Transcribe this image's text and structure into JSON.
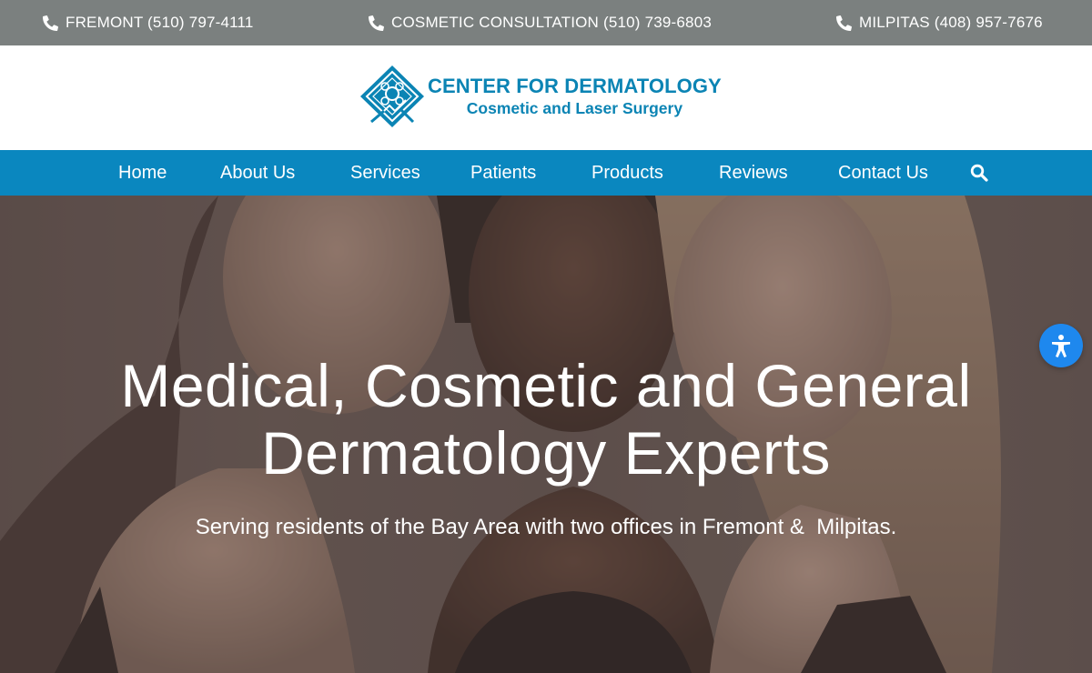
{
  "topbar": {
    "phones": [
      {
        "label": "FREMONT (510) 797-4111",
        "icon": "phone-icon"
      },
      {
        "label": "COSMETIC CONSULTATION (510) 739-6803",
        "icon": "phone-icon"
      },
      {
        "label": "MILPITAS (408) 957-7676",
        "icon": "phone-icon"
      }
    ]
  },
  "header": {
    "logo_title": "CENTER FOR DERMATOLOGY",
    "logo_subtitle": "Cosmetic and Laser Surgery"
  },
  "nav": {
    "items": [
      "Home",
      "About Us",
      "Services",
      "Patients",
      "Products",
      "Reviews",
      "Contact Us"
    ],
    "search_icon": "search-icon"
  },
  "hero": {
    "heading_line1": "Medical, Cosmetic and General",
    "heading_line2": "Dermatology Experts",
    "subheading": "Serving residents of the Bay Area with two offices in Fremont &  Milpitas."
  },
  "accessibility": {
    "icon": "accessibility-icon"
  },
  "colors": {
    "topbar": "#7b807f",
    "brand": "#0b84b4",
    "nav": "#0a87bf",
    "accessibility_button": "#1e88ee"
  }
}
